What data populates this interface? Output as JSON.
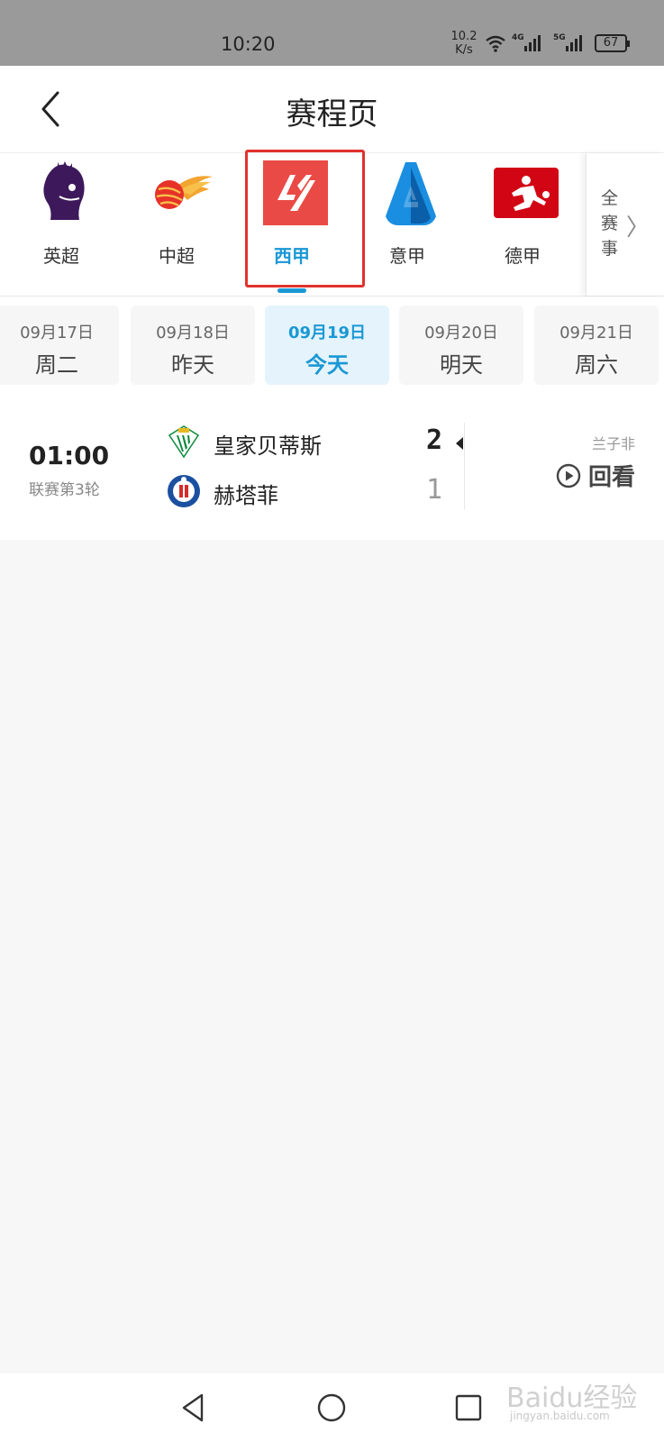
{
  "status_bar": {
    "time": "10:20",
    "net_speed_value": "10.2",
    "net_speed_unit": "K/s",
    "signal_1_gen": "4G",
    "signal_2_gen": "5G",
    "battery": "67"
  },
  "header": {
    "title": "赛程页"
  },
  "leagues": {
    "items": [
      {
        "label": "英超",
        "icon": "premier-league-logo"
      },
      {
        "label": "中超",
        "icon": "csl-logo"
      },
      {
        "label": "西甲",
        "icon": "laliga-logo",
        "active": true
      },
      {
        "label": "意甲",
        "icon": "serie-a-logo"
      },
      {
        "label": "德甲",
        "icon": "bundesliga-logo"
      }
    ],
    "all_events": "全赛事",
    "all_events_1": "全",
    "all_events_2": "赛",
    "all_events_3": "事"
  },
  "dates": [
    {
      "date": "09月17日",
      "day": "周二"
    },
    {
      "date": "09月18日",
      "day": "昨天"
    },
    {
      "date": "09月19日",
      "day": "今天",
      "active": true
    },
    {
      "date": "09月20日",
      "day": "明天"
    },
    {
      "date": "09月21日",
      "day": "周六"
    }
  ],
  "match": {
    "time": "01:00",
    "round": "联赛第3轮",
    "home_team": "皇家贝蒂斯",
    "home_score": "2",
    "away_team": "赫塔菲",
    "away_score": "1",
    "commentator": "兰子非",
    "replay_label": "回看"
  },
  "watermark": {
    "brand": "Baidu经验",
    "url": "jingyan.baidu.com"
  },
  "colors": {
    "accent": "#1a98d5",
    "highlight": "#e0322c",
    "laliga": "#ea4a45"
  }
}
